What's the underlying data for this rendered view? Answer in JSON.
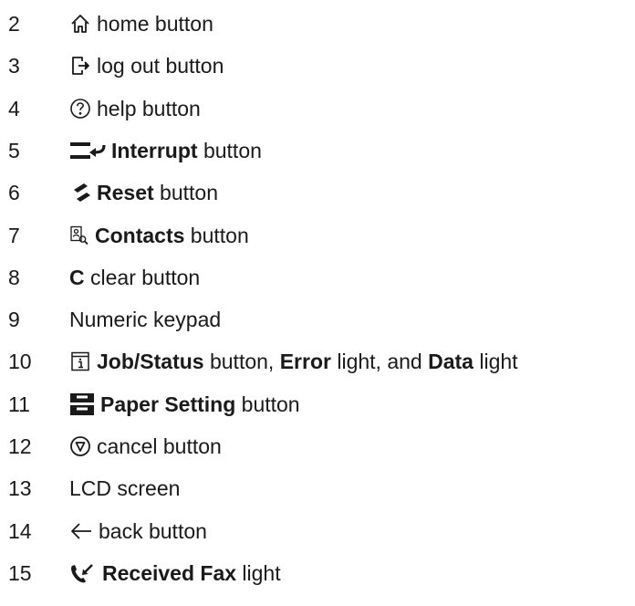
{
  "items": [
    {
      "number": "2",
      "icon": "home-icon",
      "parts": [
        {
          "t": "home button",
          "b": false
        }
      ]
    },
    {
      "number": "3",
      "icon": "log-out-icon",
      "parts": [
        {
          "t": "log out button",
          "b": false
        }
      ]
    },
    {
      "number": "4",
      "icon": "help-icon",
      "parts": [
        {
          "t": "help button",
          "b": false
        }
      ]
    },
    {
      "number": "5",
      "icon": "interrupt-icon",
      "parts": [
        {
          "t": "Interrupt",
          "b": true
        },
        {
          "t": " button",
          "b": false
        }
      ]
    },
    {
      "number": "6",
      "icon": "reset-icon",
      "parts": [
        {
          "t": "Reset",
          "b": true
        },
        {
          "t": " button",
          "b": false
        }
      ]
    },
    {
      "number": "7",
      "icon": "contacts-icon",
      "parts": [
        {
          "t": "Contacts",
          "b": true
        },
        {
          "t": " button",
          "b": false
        }
      ]
    },
    {
      "number": "8",
      "icon": "",
      "parts": [
        {
          "t": "C",
          "b": true
        },
        {
          "t": " clear button",
          "b": false
        }
      ]
    },
    {
      "number": "9",
      "icon": "",
      "parts": [
        {
          "t": "Numeric keypad",
          "b": false
        }
      ]
    },
    {
      "number": "10",
      "icon": "job-status-icon",
      "parts": [
        {
          "t": "Job/Status",
          "b": true
        },
        {
          "t": " button, ",
          "b": false
        },
        {
          "t": "Error",
          "b": true
        },
        {
          "t": " light, and ",
          "b": false
        },
        {
          "t": "Data",
          "b": true
        },
        {
          "t": " light",
          "b": false
        }
      ]
    },
    {
      "number": "11",
      "icon": "paper-setting-icon",
      "parts": [
        {
          "t": "Paper Setting",
          "b": true
        },
        {
          "t": " button",
          "b": false
        }
      ]
    },
    {
      "number": "12",
      "icon": "cancel-icon",
      "parts": [
        {
          "t": "cancel button",
          "b": false
        }
      ]
    },
    {
      "number": "13",
      "icon": "",
      "parts": [
        {
          "t": "LCD screen",
          "b": false
        }
      ]
    },
    {
      "number": "14",
      "icon": "back-arrow-icon",
      "parts": [
        {
          "t": "back button",
          "b": false
        }
      ]
    },
    {
      "number": "15",
      "icon": "received-fax-icon",
      "parts": [
        {
          "t": "Received Fax",
          "b": true
        },
        {
          "t": " light",
          "b": false
        }
      ]
    }
  ]
}
